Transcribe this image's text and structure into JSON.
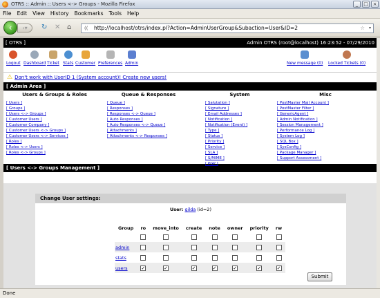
{
  "window": {
    "title": "OTRS :: Admin :: Users <-> Groups - Mozilla Firefox"
  },
  "menu": [
    "File",
    "Edit",
    "View",
    "History",
    "Bookmarks",
    "Tools",
    "Help"
  ],
  "url": "http://localhost/otrs/index.pl?Action=AdminUserGroup&Subaction=User&ID=2",
  "header": {
    "brand": "[ OTRS ]",
    "session": "Admin OTRS (root@localhost) 16:23:52 - 07/29/2010"
  },
  "toolbar": {
    "items": [
      "Logout",
      "Dashboard",
      "Ticket",
      "Stats",
      "Customer",
      "Preferences",
      "Admin"
    ],
    "new_message": "New message (0)",
    "locked_tickets": "Locked Tickets (0)"
  },
  "warning": "Don't work with UserID 1 (System account)! Create new users!",
  "admin_area": {
    "heading": "[ Admin Area ]",
    "columns": [
      {
        "title": "Users & Groups & Roles",
        "links": [
          "[ Users ]",
          "[ Groups ]",
          "[ Users <-> Groups ]",
          "[ Customer Users ]",
          "[ Customer Company ]",
          "[ Customer Users <-> Groups ]",
          "[ Customer Users <-> Services ]",
          "[ Roles ]",
          "[ Roles <-> Users ]",
          "[ Roles <-> Groups ]"
        ]
      },
      {
        "title": "Queue & Responses",
        "links": [
          "[ Queue ]",
          "[ Responses ]",
          "[ Responses <-> Queue ]",
          "[ Auto Responses ]",
          "[ Auto Responses <-> Queue ]",
          "[ Attachments ]",
          "[ Attachments <-> Responses ]"
        ]
      },
      {
        "title": "System",
        "links": [
          "[ Salutation ]",
          "[ Signature ]",
          "[ Email Addresses ]",
          "[ Notification ]",
          "[ Notification (Event) ]",
          "[ Type ]",
          "[ Status ]",
          "[ Priority ]",
          "[ Service ]",
          "[ SLA ]",
          "[ S/MIME ]",
          "[ PGP ]"
        ]
      },
      {
        "title": "Misc",
        "links": [
          "[ PostMaster Mail Account ]",
          "[ PostMaster Filter ]",
          "[ GenericAgent ]",
          "[ Admin Notification ]",
          "[ Session Management ]",
          "[ Performance Log ]",
          "[ System Log ]",
          "[ SQL Box ]",
          "[ SysConfig ]",
          "[ Package Manager ]",
          "[ Support Assessment ]"
        ]
      }
    ]
  },
  "section": {
    "heading": "[ Users <-> Groups Management ]",
    "box_title": "Change User settings:"
  },
  "user": {
    "label": "User:",
    "name": "gilda",
    "id_text": "(id=2)"
  },
  "permissions": {
    "columns": [
      "Group",
      "ro",
      "move_into",
      "create",
      "note",
      "owner",
      "priority",
      "rw"
    ],
    "rows": [
      {
        "group": "admin",
        "checks": [
          false,
          false,
          false,
          false,
          false,
          false,
          false
        ]
      },
      {
        "group": "stats",
        "checks": [
          false,
          false,
          false,
          false,
          false,
          false,
          false
        ]
      },
      {
        "group": "users",
        "checks": [
          true,
          true,
          true,
          true,
          true,
          true,
          true
        ]
      }
    ]
  },
  "submit_label": "Submit",
  "status": "Done"
}
